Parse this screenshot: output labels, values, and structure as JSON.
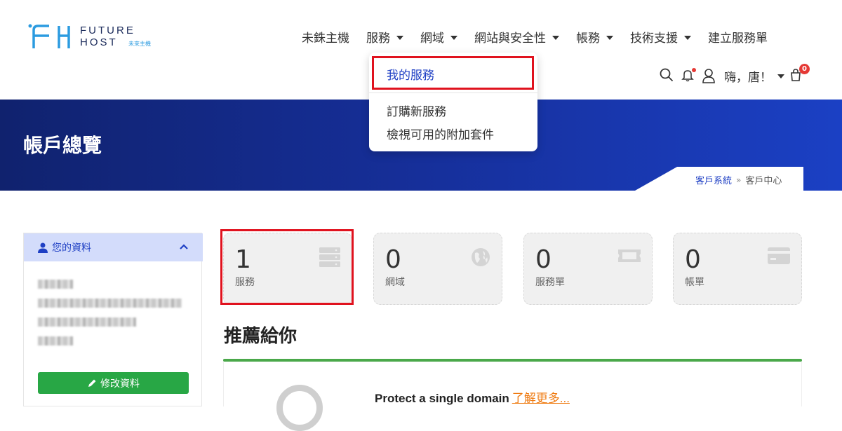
{
  "brand": {
    "word1": "FUTURE",
    "word2": "HOST",
    "subtitle": "未來主機"
  },
  "nav": {
    "items": [
      {
        "label": "未銖主機",
        "has_caret": false
      },
      {
        "label": "服務",
        "has_caret": true
      },
      {
        "label": "網域",
        "has_caret": true
      },
      {
        "label": "網站與安全性",
        "has_caret": true
      },
      {
        "label": "帳務",
        "has_caret": true
      },
      {
        "label": "技術支援",
        "has_caret": true
      },
      {
        "label": "建立服務單",
        "has_caret": false
      }
    ]
  },
  "utils": {
    "greeting": "嗨，唐！",
    "cart_count": "0"
  },
  "dropdown": {
    "items": [
      "我的服務",
      "訂購新服務",
      "檢視可用的附加套件"
    ]
  },
  "banner": {
    "title": "帳戶總覽",
    "breadcrumb_link": "客戶系統",
    "breadcrumb_sep": "»",
    "breadcrumb_current": "客戶中心"
  },
  "sidebar": {
    "title": "您的資料",
    "edit_button": "修改資料"
  },
  "stats": [
    {
      "value": "1",
      "label": "服務",
      "icon": "server-icon"
    },
    {
      "value": "0",
      "label": "網域",
      "icon": "globe-icon"
    },
    {
      "value": "0",
      "label": "服務單",
      "icon": "ticket-icon"
    },
    {
      "value": "0",
      "label": "帳單",
      "icon": "credit-card-icon"
    }
  ],
  "recommend": {
    "title": "推薦給你",
    "product_text": "Protect a single domain",
    "link_text": "了解更多..."
  },
  "colors": {
    "accent": "#1e3fc4",
    "highlight": "#e0121e",
    "success": "#28a745",
    "banner_start": "#10226e",
    "banner_end": "#1b40c4"
  }
}
